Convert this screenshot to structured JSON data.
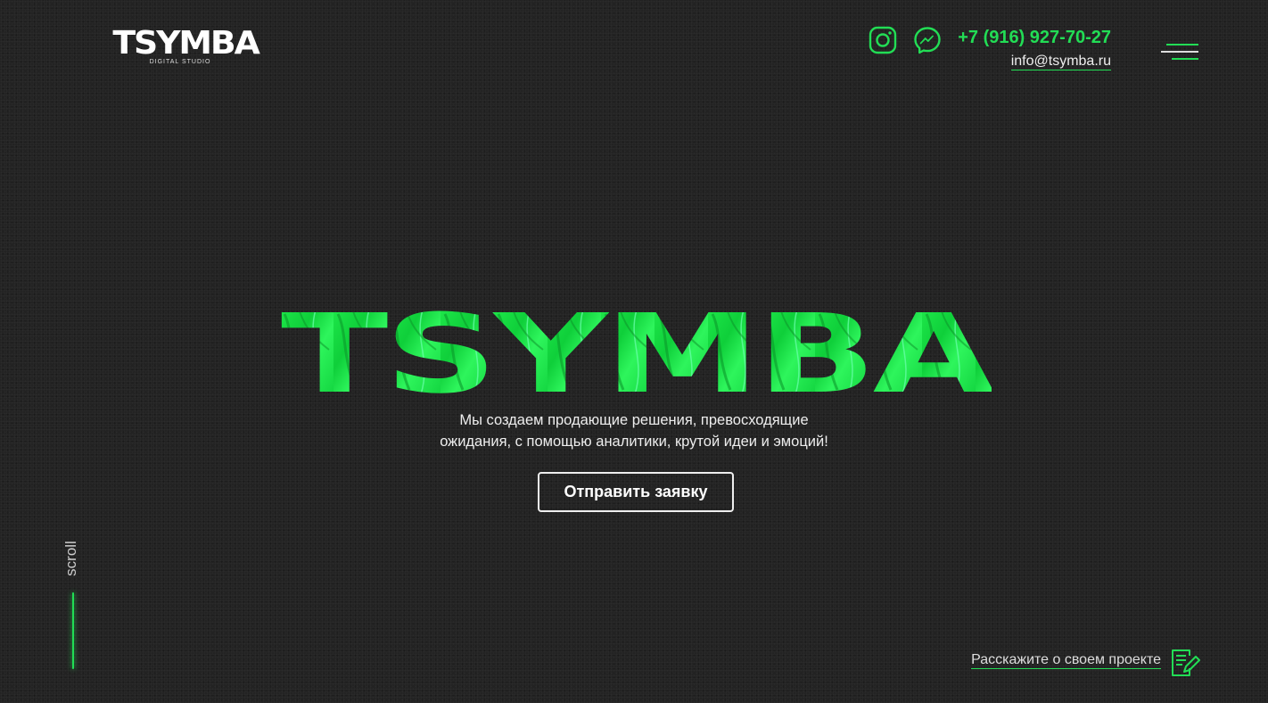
{
  "header": {
    "logo_text": "TSYMBA",
    "logo_subtitle": "DIGITAL STUDIO",
    "phone": "+7 (916) 927-70-27",
    "email": "info@tsymba.ru",
    "social_icons": [
      "instagram-icon",
      "messenger-icon"
    ],
    "menu_icon": "hamburger-menu-icon"
  },
  "hero": {
    "title": "TSYMBA",
    "subtitle_line1": "Мы создаем продающие решения, превосходящие",
    "subtitle_line2": "ожидания, с помощью аналитики, крутой идеи и эмоций!",
    "cta_label": "Отправить заявку"
  },
  "scroll": {
    "label": "scroll"
  },
  "footer": {
    "project_link": "Расскажите о своем проекте",
    "project_icon": "document-edit-icon"
  },
  "colors": {
    "background": "#232323",
    "accent": "#22dd55",
    "text": "#ffffff"
  }
}
